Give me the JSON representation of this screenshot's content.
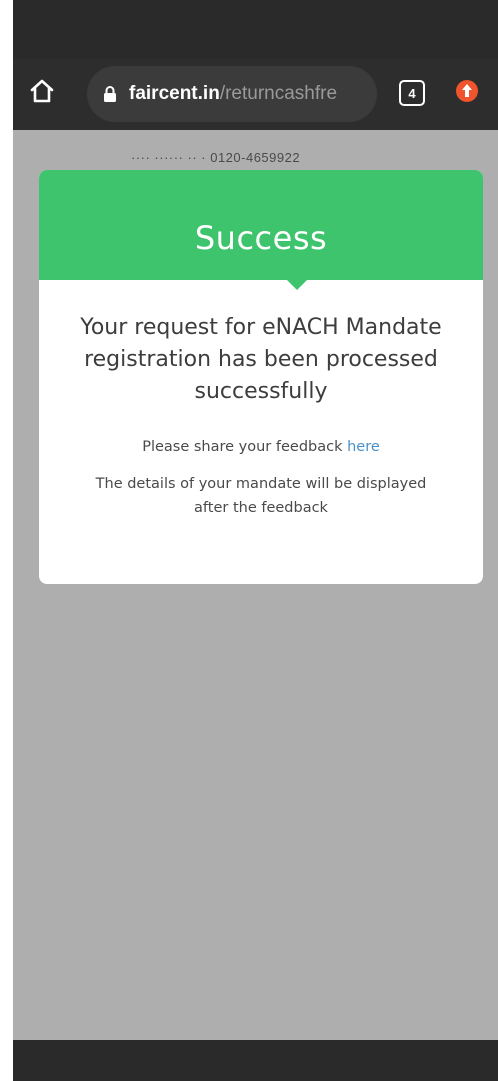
{
  "browser": {
    "url_domain": "faircent.in",
    "url_path": "/returncashfre",
    "tab_count": "4"
  },
  "background": {
    "contact_text": "···· ······ ·· ·  0120-4659922"
  },
  "modal": {
    "title": "Success",
    "message": "Your request for eNACH Mandate registration has been processed successfully",
    "feedback_prefix": "Please share your feedback ",
    "feedback_link": "here",
    "details": "The details of your mandate will be displayed after the feedback"
  },
  "colors": {
    "success_green": "#3ec46d",
    "link_blue": "#4a90c8",
    "overlay_gray": "#aeaeae",
    "chrome_dark": "#2d2d2d"
  },
  "icons": {
    "home": "home-icon",
    "lock": "lock-icon",
    "tabs": "tabs-icon",
    "update": "update-icon"
  }
}
